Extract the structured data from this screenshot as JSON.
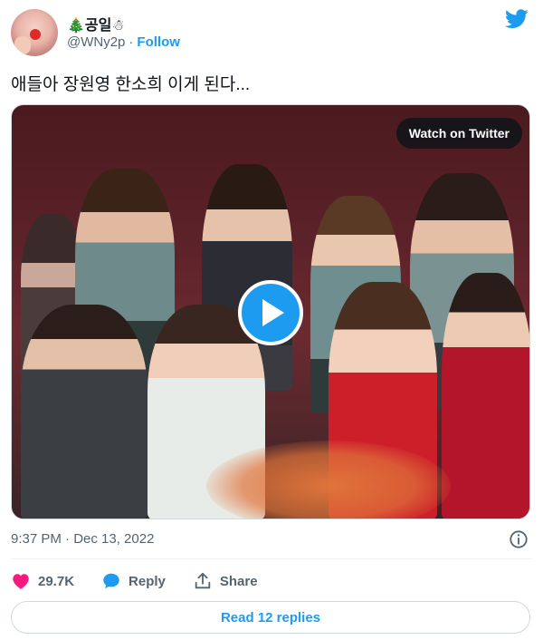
{
  "user": {
    "display_name": "🎄공일☃",
    "handle": "@WNy2p",
    "separator": "·",
    "follow_label": "Follow"
  },
  "tweet": {
    "text": "애들아 장원영 한소희 이게 된다..."
  },
  "media": {
    "watch_label": "Watch on Twitter"
  },
  "meta": {
    "timestamp": "9:37 PM · Dec 13, 2022"
  },
  "actions": {
    "like_count": "29.7K",
    "reply_label": "Reply",
    "share_label": "Share"
  },
  "replies": {
    "label": "Read 12 replies"
  },
  "colors": {
    "accent": "#1d9bf0",
    "like": "#f91880",
    "muted": "#536471"
  }
}
